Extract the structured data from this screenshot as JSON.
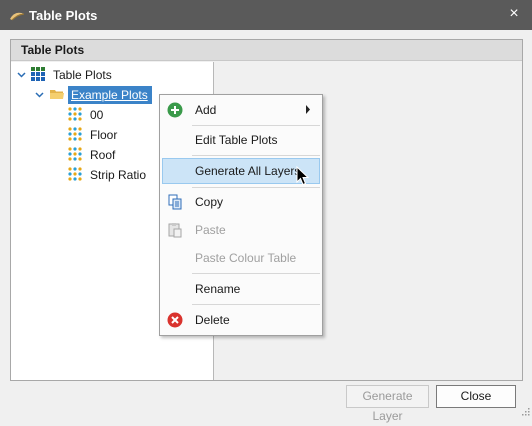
{
  "window": {
    "title": "Table Plots",
    "close_symbol": "×"
  },
  "panel": {
    "title": "Table Plots"
  },
  "tree": {
    "root": {
      "label": "Table Plots",
      "expanded": true
    },
    "folder": {
      "label": "Example Plots",
      "expanded": true,
      "selected": true
    },
    "plots": [
      {
        "label": "00"
      },
      {
        "label": "Floor"
      },
      {
        "label": "Roof"
      },
      {
        "label": "Strip Ratio"
      }
    ]
  },
  "context_menu": {
    "items": [
      {
        "label": "Add",
        "icon": "add-icon",
        "has_submenu": true,
        "enabled": true
      },
      {
        "label": "Edit Table Plots",
        "enabled": true
      },
      {
        "label": "Generate All Layers",
        "enabled": true,
        "highlighted": true
      },
      {
        "label": "Copy",
        "icon": "copy-icon",
        "enabled": true
      },
      {
        "label": "Paste",
        "icon": "paste-icon",
        "enabled": false
      },
      {
        "label": "Paste Colour Table",
        "enabled": false
      },
      {
        "label": "Rename",
        "enabled": true
      },
      {
        "label": "Delete",
        "icon": "delete-icon",
        "enabled": true
      }
    ]
  },
  "buttons": {
    "generate_layer": "Generate Layer",
    "generate_layer_enabled": false,
    "close": "Close"
  },
  "colors": {
    "titlebar": "#5a5a5a",
    "selection": "#3b83c8",
    "menu_highlight": "#cce4f7",
    "add_green": "#3a9a4a",
    "delete_red": "#d9332e"
  }
}
